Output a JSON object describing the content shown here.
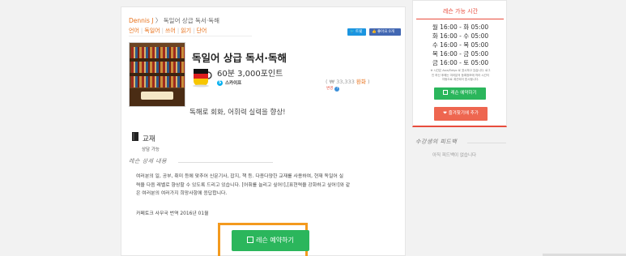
{
  "breadcrumb": {
    "teacher": "Dennis J",
    "sep": " 〉 ",
    "lesson": "독일어 상급 독서·독해"
  },
  "categories": [
    "언어",
    "독일어",
    "쓰어",
    "읽기",
    "단어"
  ],
  "share": {
    "twitter": "🐦 트윗",
    "facebook": "👍 좋아요 0개"
  },
  "lesson": {
    "title": "독일어 상급 독서·독해",
    "points": "60분 3,000포인트",
    "platform": "스카이프",
    "price_prefix": "( ₩ 33,333 ",
    "price_currency": "환화",
    "price_suffix": " )",
    "change_label": "변경",
    "summary": "독해로 회화, 어휘력 실력을 향상!"
  },
  "material": {
    "label": "교재",
    "value": "상담 가능"
  },
  "detail": {
    "heading": "레슨 상세 내용",
    "lines": [
      "여러분의 일, 공부, 취미 등에 맞추어 신문기사, 잡지, 책 등. 다종다양한 교재를 사용하여, 현재 독일어 실",
      "력을 다음 레벨로 향상할 수 있도록 드리고 있습니다. [어휘를 늘리고 싶어!],[표현력을 강화하고 싶어!]와 같",
      "은 여러분의 여러가지 희망사항에 응답합니다."
    ],
    "note": "카페토크 사무국 번역 2016년 01월"
  },
  "book_button": "레슨 예약하기",
  "sidebar": {
    "title": "레슨 가능 시간",
    "schedule": [
      "월 16:00 - 화 05:00",
      "화 16:00 - 수 05:00",
      "수 16:00 - 목 05:00",
      "목 16:00 - 금 05:00",
      "금 16:00 - 토 05:00"
    ],
    "note_lines": [
      "※ 시간은 Asia/Tokyo 로 표시하고 있습니다. 로그",
      "인 하신 후에는 여러분의 등록정보에 따라 시간이",
      "자동으로 계산되어 표시됩니다."
    ],
    "book_button": "레슨 예약하기",
    "fav_button": "즐겨찾기에 추가"
  },
  "feedback": {
    "heading": "수강생의 피드백",
    "empty": "아직 피드백이 없습니다"
  },
  "colors": {
    "accent": "#e8711a",
    "green": "#2bb65c",
    "red": "#e84c3d",
    "highlight": "#f39a1e"
  }
}
